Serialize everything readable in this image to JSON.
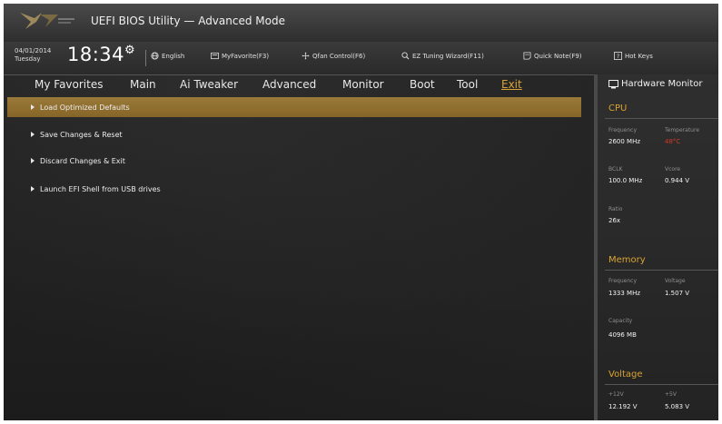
{
  "window": {
    "title": "UEFI BIOS Utility — Advanced Mode"
  },
  "infobar": {
    "date": "04/01/2014",
    "day": "Tuesday",
    "time": "18:34",
    "items": [
      {
        "icon": "globe-icon",
        "label": "English"
      },
      {
        "icon": "star-icon",
        "label": "MyFavorite(F3)"
      },
      {
        "icon": "fan-icon",
        "label": "Qfan Control(F6)"
      },
      {
        "icon": "tuning-wizard-icon",
        "label": "EZ Tuning Wizard(F11)"
      },
      {
        "icon": "note-icon",
        "label": "Quick Note(F9)"
      },
      {
        "icon": "help-icon",
        "label": "Hot Keys"
      }
    ]
  },
  "nav": {
    "tabs": [
      "My Favorites",
      "Main",
      "Ai Tweaker",
      "Advanced",
      "Monitor",
      "Boot",
      "Tool",
      "Exit"
    ],
    "active": "Exit"
  },
  "menu": {
    "items": [
      "Load Optimized Defaults",
      "Save Changes & Reset",
      "Discard Changes & Exit",
      "Launch EFI Shell from USB drives"
    ],
    "selected_index": 0
  },
  "hardware_monitor": {
    "title": "Hardware Monitor",
    "accent_color": "#d9a431",
    "cpu": {
      "title": "CPU",
      "frequency_label": "Frequency",
      "frequency": "2600 MHz",
      "temperature_label": "Temperature",
      "temperature": "48°C",
      "bclk_label": "BCLK",
      "bclk": "100.0 MHz",
      "vcore_label": "Vcore",
      "vcore": "0.944 V",
      "ratio_label": "Ratio",
      "ratio": "26x"
    },
    "memory": {
      "title": "Memory",
      "frequency_label": "Frequency",
      "frequency": "1333 MHz",
      "voltage_label": "Voltage",
      "voltage": "1.507 V",
      "capacity_label": "Capacity",
      "capacity": "4096 MB"
    },
    "voltage": {
      "title": "Voltage",
      "v12_label": "+12V",
      "v12": "12.192 V",
      "v5_label": "+5V",
      "v5": "5.083 V"
    }
  }
}
